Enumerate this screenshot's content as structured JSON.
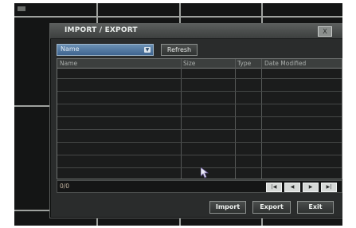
{
  "dialog": {
    "title": "IMPORT / EXPORT",
    "close_label": "X"
  },
  "toolbar": {
    "sort_selected": "Name",
    "refresh_label": "Refresh"
  },
  "table": {
    "columns": [
      "Name",
      "Size",
      "Type",
      "Date Modified"
    ],
    "rows": []
  },
  "pager": {
    "count": "0/0"
  },
  "actions": {
    "import_label": "Import",
    "export_label": "Export",
    "exit_label": "Exit"
  },
  "icons": {
    "dropdown": "chevron-down-icon",
    "close": "close-icon",
    "first": "first-page-icon",
    "prev": "prev-page-icon",
    "next": "next-page-icon",
    "last": "last-page-icon",
    "cursor": "mouse-pointer-icon"
  },
  "colors": {
    "dropdown_accent": "#4f749c",
    "dialog_bg": "#2a2c2c",
    "grid_line": "#9ea19e"
  }
}
